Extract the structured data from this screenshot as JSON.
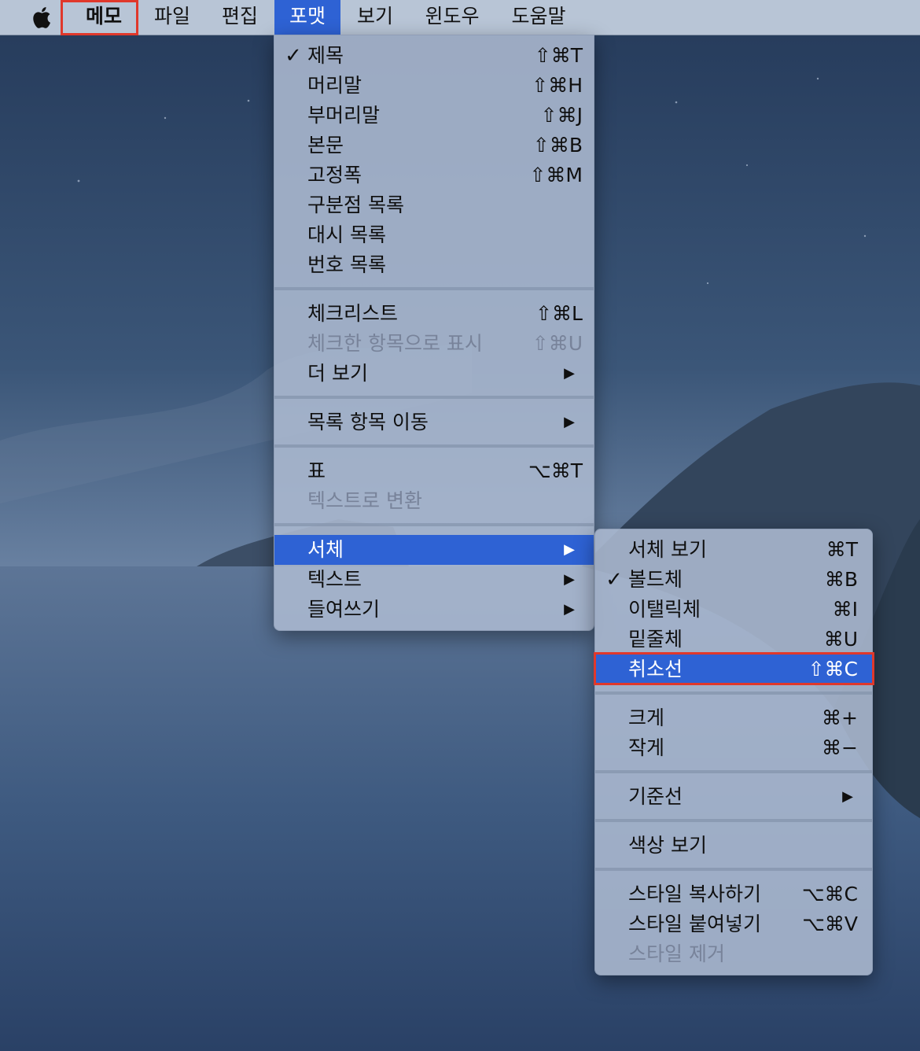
{
  "menubar": {
    "items": [
      "메모",
      "파일",
      "편집",
      "포맷",
      "보기",
      "윈도우",
      "도움말"
    ]
  },
  "format_menu": {
    "items": [
      {
        "label": "제목",
        "shortcut": "⇧⌘T",
        "checked": true
      },
      {
        "label": "머리말",
        "shortcut": "⇧⌘H"
      },
      {
        "label": "부머리말",
        "shortcut": "⇧⌘J"
      },
      {
        "label": "본문",
        "shortcut": "⇧⌘B"
      },
      {
        "label": "고정폭",
        "shortcut": "⇧⌘M"
      },
      {
        "label": "구분점 목록"
      },
      {
        "label": "대시 목록"
      },
      {
        "label": "번호 목록"
      },
      {
        "label": "체크리스트",
        "shortcut": "⇧⌘L"
      },
      {
        "label": "체크한 항목으로 표시",
        "shortcut": "⇧⌘U",
        "disabled": true
      },
      {
        "label": "더 보기",
        "submenu": true
      },
      {
        "label": "목록 항목 이동",
        "submenu": true
      },
      {
        "label": "표",
        "shortcut": "⌥⌘T"
      },
      {
        "label": "텍스트로 변환",
        "disabled": true
      },
      {
        "label": "서체",
        "submenu": true,
        "highlighted": true
      },
      {
        "label": "텍스트",
        "submenu": true
      },
      {
        "label": "들여쓰기",
        "submenu": true
      }
    ]
  },
  "font_submenu": {
    "items": [
      {
        "label": "서체 보기",
        "shortcut": "⌘T"
      },
      {
        "label": "볼드체",
        "shortcut": "⌘B",
        "checked": true
      },
      {
        "label": "이탤릭체",
        "shortcut": "⌘I"
      },
      {
        "label": "밑줄체",
        "shortcut": "⌘U"
      },
      {
        "label": "취소선",
        "shortcut": "⇧⌘C",
        "highlighted": true
      },
      {
        "label": "크게",
        "shortcut": "⌘+"
      },
      {
        "label": "작게",
        "shortcut": "⌘−"
      },
      {
        "label": "기준선",
        "submenu": true
      },
      {
        "label": "색상 보기"
      },
      {
        "label": "스타일 복사하기",
        "shortcut": "⌥⌘C"
      },
      {
        "label": "스타일 붙여넣기",
        "shortcut": "⌥⌘V"
      },
      {
        "label": "스타일 제거",
        "disabled": true
      }
    ]
  },
  "glyphs": {
    "check": "✓",
    "arrow": "▶"
  },
  "icons": {
    "apple": "apple-logo-icon"
  },
  "colors": {
    "highlight": "#2e62d4",
    "annotation": "#e0382b"
  }
}
